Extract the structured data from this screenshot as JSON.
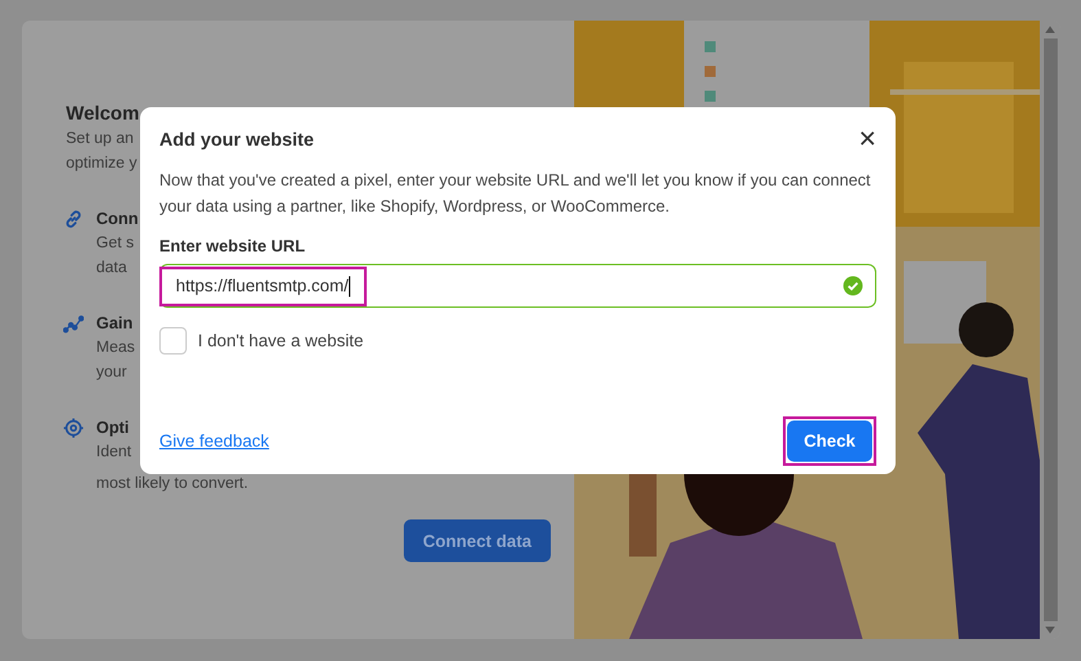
{
  "background": {
    "title": "Welcom",
    "subtitle_lines": [
      "Set up an",
      "optimize y"
    ],
    "features": [
      {
        "kind": "link",
        "title": "Conn",
        "lines": [
          "Get s",
          "data"
        ]
      },
      {
        "kind": "chart",
        "title": "Gain",
        "lines": [
          "Meas",
          "your"
        ]
      },
      {
        "kind": "target",
        "title": "Opti",
        "lines": [
          "Ident",
          "most likely to convert."
        ]
      }
    ],
    "button": "Connect data"
  },
  "dialog": {
    "title": "Add your website",
    "close": "×",
    "description": "Now that you've created a pixel, enter your website URL and we'll let you know if you can connect your data using a partner, like Shopify, Wordpress, or WooCommerce.",
    "url_field": {
      "label": "Enter website URL",
      "value": "https://fluentsmtp.com/",
      "valid": true,
      "highlighted": true
    },
    "no_website": {
      "label": "I don't have a website",
      "checked": false
    },
    "feedback_link": "Give feedback",
    "check_button": {
      "label": "Check",
      "highlighted": true
    }
  }
}
